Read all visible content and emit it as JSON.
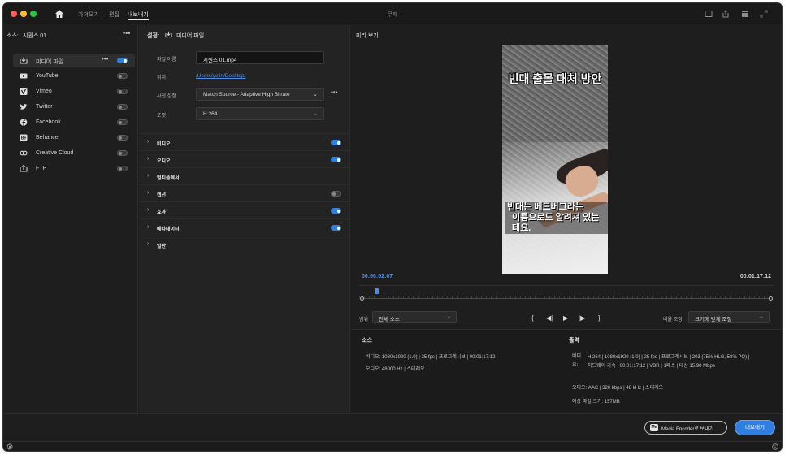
{
  "window": {
    "title": "무제"
  },
  "topnav": {
    "import": "가져오기",
    "edit": "편집",
    "export": "내보내기"
  },
  "left": {
    "source_label": "소스:",
    "source_value": "시퀀스 01",
    "more": "•••",
    "destinations": [
      {
        "label": "미디어 파일",
        "icon": "media-file-icon",
        "on": true
      },
      {
        "label": "YouTube",
        "icon": "youtube-icon",
        "on": false
      },
      {
        "label": "Vimeo",
        "icon": "vimeo-icon",
        "on": false
      },
      {
        "label": "Twitter",
        "icon": "twitter-icon",
        "on": false
      },
      {
        "label": "Facebook",
        "icon": "facebook-icon",
        "on": false
      },
      {
        "label": "Behance",
        "icon": "behance-icon",
        "on": false
      },
      {
        "label": "Creative Cloud",
        "icon": "creative-cloud-icon",
        "on": false
      },
      {
        "label": "FTP",
        "icon": "ftp-icon",
        "on": false
      }
    ]
  },
  "settings": {
    "header": "설정:",
    "header_target": "미디어 파일",
    "filename_label": "파일 이름",
    "filename_value": "시퀀스 01.mp4",
    "location_label": "위치",
    "location_value": "/Users/yejin/Desktop/",
    "preset_label": "사전 설정",
    "preset_value": "Match Source - Adaptive High Bitrate",
    "format_label": "포맷",
    "format_value": "H.264",
    "more": "•••",
    "sections": [
      {
        "name": "비디오",
        "toggle": true,
        "on": true
      },
      {
        "name": "오디오",
        "toggle": true,
        "on": true
      },
      {
        "name": "멀티플렉서",
        "toggle": false,
        "on": false
      },
      {
        "name": "캡션",
        "toggle": true,
        "on": false
      },
      {
        "name": "효과",
        "toggle": true,
        "on": true
      },
      {
        "name": "메타데이터",
        "toggle": true,
        "on": true
      },
      {
        "name": "일반",
        "toggle": false,
        "on": false
      }
    ]
  },
  "preview": {
    "header": "미리 보기",
    "caption_top": "빈대 출몰 대처 방안",
    "caption_bottom_1": "빈대는 베드버그라는",
    "caption_bottom_2": "이름으로도 알려져 있는데요.",
    "timecode_current": "00:00:02:07",
    "timecode_total": "00:01:17:12",
    "playhead_fraction": 0.03,
    "range_label": "범위",
    "range_value": "전체 소스",
    "scale_label": "비율 조정",
    "scale_value": "크기에 맞게 조절",
    "controls": {
      "in": "{",
      "step_back": "◀|",
      "play": "▶",
      "step_fwd": "|▶",
      "out": "}"
    }
  },
  "summary": {
    "source_title": "소스",
    "source_video": "비디오:  1080x1920 (1.0)  |  25 fps  |  프로그레시브  |  00:01:17:12",
    "source_audio": "오디오:  48000 Hz  |  스테레오",
    "output_title": "출력",
    "out_video_lbl": "비디오:",
    "out_video_1": "H.264  |  1080x1920 (1.0)  |  25 fps  |  프로그레시브  |  203 (75% HLG, 58% PQ)  |",
    "out_video_2": "하드웨어 가속  |  00:01:17:12  |  VBR  |  1패스  |  대상 15.90 Mbps",
    "out_audio": "오디오:  AAC  |  320 kbps  |  48 kHz  |  스테레오",
    "out_size": "예상 파일 크기:  157MB"
  },
  "footer": {
    "media_encoder_label": "Media Encoder로 보내기",
    "media_encoder_badge": "Me",
    "export_label": "내보내기"
  },
  "colors": {
    "accent": "#2f7ee0",
    "background": "#1e1e1e"
  }
}
